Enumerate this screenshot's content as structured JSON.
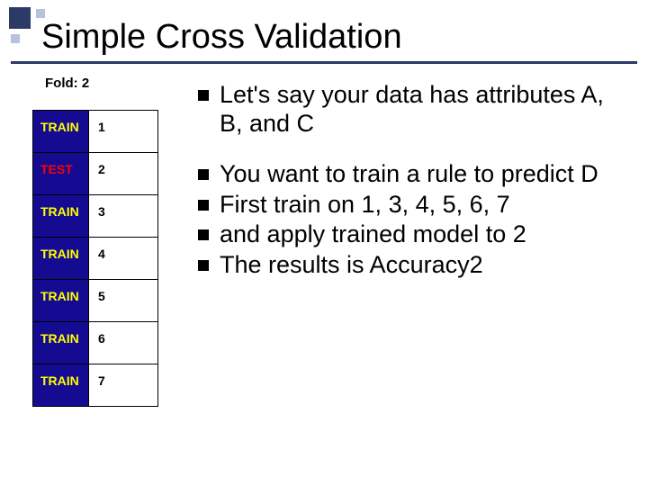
{
  "title": "Simple Cross Validation",
  "fold_label": "Fold: 2",
  "table": {
    "rows": [
      {
        "kind": "train",
        "label": "TRAIN",
        "num": "1"
      },
      {
        "kind": "test",
        "label": "TEST",
        "num": "2"
      },
      {
        "kind": "train",
        "label": "TRAIN",
        "num": "3"
      },
      {
        "kind": "train",
        "label": "TRAIN",
        "num": "4"
      },
      {
        "kind": "train",
        "label": "TRAIN",
        "num": "5"
      },
      {
        "kind": "train",
        "label": "TRAIN",
        "num": "6"
      },
      {
        "kind": "train",
        "label": "TRAIN",
        "num": "7"
      }
    ]
  },
  "bullets_top": [
    "Let's say your data has attributes A, B, and C"
  ],
  "bullets_bottom": [
    "You want to train a rule to predict D",
    "First train on 1, 3, 4, 5, 6, 7",
    "and apply trained model to 2",
    "The results is Accuracy2"
  ]
}
